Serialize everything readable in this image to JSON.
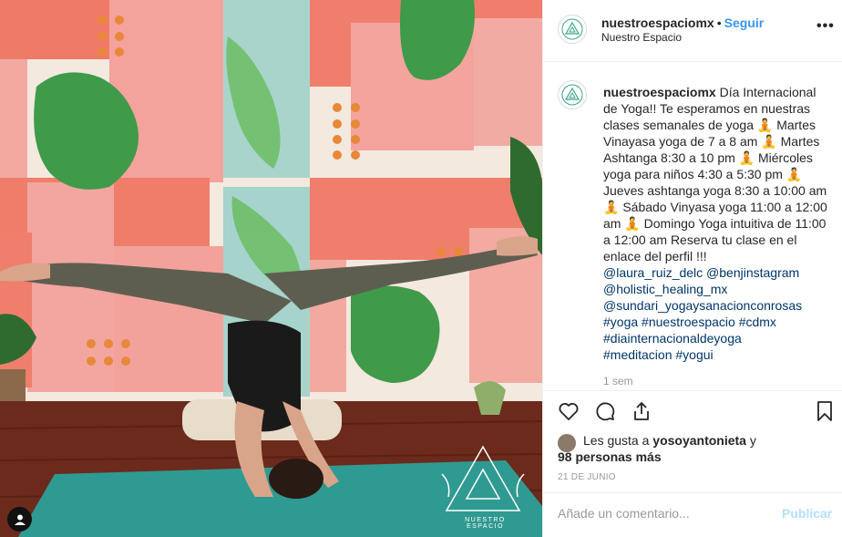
{
  "post": {
    "username": "nuestroespaciomx",
    "follow_label": "Seguir",
    "separator": "•",
    "location": "Nuestro Espacio",
    "more_label": "•••",
    "caption_user": "nuestroespaciomx",
    "caption_text": "Día Internacional de Yoga!! Te esperamos en nuestras clases semanales de yoga 🧘 Martes Vinayasa yoga de 7 a 8 am 🧘 Martes Ashtanga 8:30 a 10 pm 🧘 Miércoles yoga para niños 4:30 a 5:30 pm 🧘 Jueves ashtanga yoga 8:30 a 10:00 am 🧘 Sábado Vinyasa yoga 11:00 a 12:00 am 🧘 Domingo Yoga intuitiva de 11:00 a 12:00 am Reserva tu clase en el enlace del perfil !!!",
    "mentions": [
      "@laura_ruiz_delc",
      "@benjinstagram",
      "@holistic_healing_mx",
      "@sundari_yogaysanacionconrosas"
    ],
    "hashtags": [
      "#yoga",
      "#nuestroespacio",
      "#cdmx",
      "#diainternacionaldeyoga",
      "#meditacion",
      "#yogui"
    ],
    "time_ago": "1 sem",
    "likes_prefix": "Les gusta a",
    "likes_user": "yosoyantonieta",
    "likes_and": "y",
    "likes_others": "98 personas más",
    "date": "21 DE JUNIO",
    "comment_placeholder": "Añade un comentario...",
    "publish_label": "Publicar"
  },
  "photo": {
    "watermark_text": "NUESTRO ESPACIO"
  },
  "icons": {
    "like": "heart-icon",
    "comment": "comment-icon",
    "share": "share-icon",
    "save": "bookmark-icon",
    "user_tags": "user-tag-icon"
  },
  "colors": {
    "follow": "#3897f0",
    "publish_disabled": "#b2dffc",
    "hashtag": "#003569",
    "brand_logo": "#3aa58a"
  }
}
